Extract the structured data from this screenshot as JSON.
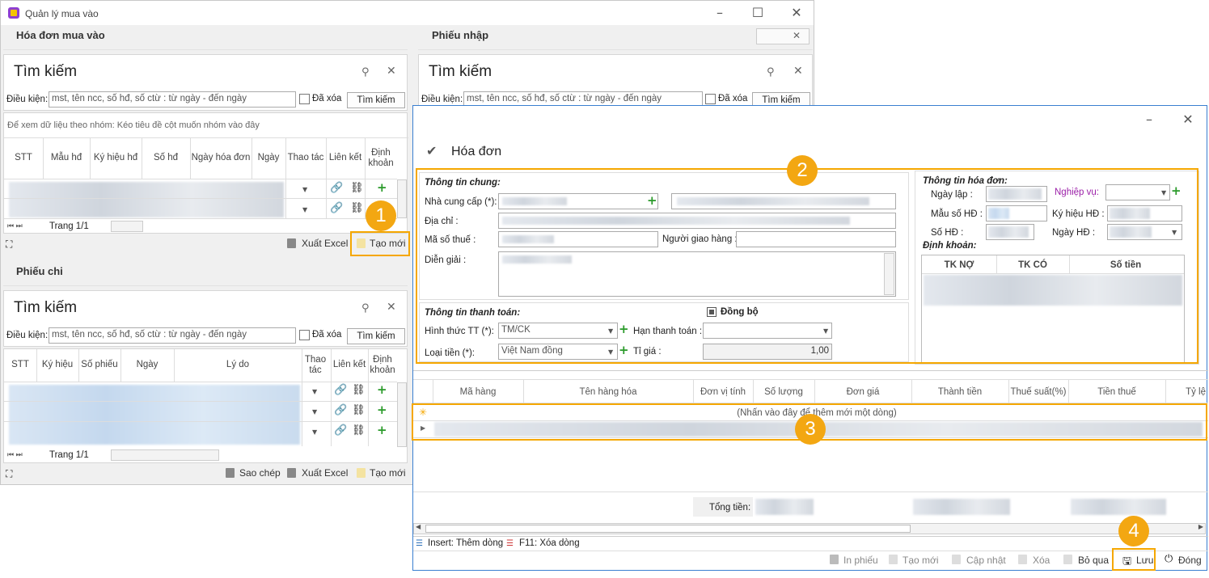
{
  "window": {
    "title": "Quản lý mua vào"
  },
  "hoa_don_mua_vao": {
    "section_title": "Hóa đơn mua vào",
    "search": {
      "title": "Tìm kiếm",
      "label": "Điều kiện:",
      "placeholder": "mst, tên ncc, số hđ, số ctừ : từ ngày - đến ngày",
      "deleted_label": "Đã xóa",
      "button": "Tìm kiếm"
    },
    "group_hint": "Để xem dữ liệu theo nhóm: Kéo tiêu đề cột muốn nhóm vào đây",
    "columns": [
      "STT",
      "Mẫu hđ",
      "Ký hiệu hđ",
      "Số hđ",
      "Ngày hóa đơn",
      "Ngày",
      "Thao tác",
      "Liên kết",
      "Định khoản"
    ],
    "pager": "Trang 1/1",
    "footer": {
      "excel": "Xuất Excel",
      "new": "Tạo mới"
    }
  },
  "phieu_nhap": {
    "section_title": "Phiếu nhập",
    "search": {
      "title": "Tìm kiếm",
      "label": "Điều kiện:",
      "placeholder": "mst, tên ncc, số hđ, số ctừ : từ ngày - đến ngày",
      "deleted_label": "Đã xóa",
      "button": "Tìm kiếm"
    }
  },
  "phieu_chi": {
    "section_title": "Phiếu chi",
    "search": {
      "title": "Tìm kiếm",
      "label": "Điều kiện:",
      "placeholder": "mst, tên ncc, số hđ, số ctừ : từ ngày - đến ngày",
      "deleted_label": "Đã xóa",
      "button": "Tìm kiếm"
    },
    "columns": [
      "STT",
      "Ký hiệu",
      "Số phiếu",
      "Ngày",
      "Lý do",
      "Thao tác",
      "Liên kết",
      "Định khoản"
    ],
    "pager": "Trang 1/1",
    "footer": {
      "copy": "Sao chép",
      "excel": "Xuất Excel",
      "new": "Tạo mới"
    }
  },
  "dialog": {
    "title": "Hóa đơn",
    "general": {
      "heading": "Thông tin chung:",
      "supplier": "Nhà cung cấp (*):",
      "address": "Địa chỉ :",
      "tax_code": "Mã số thuế :",
      "deliverer": "Người giao hàng :",
      "description": "Diễn giải :"
    },
    "payment": {
      "heading": "Thông tin thanh toán:",
      "sync": "Đồng bộ",
      "method_label": "Hình thức TT (*):",
      "method_value": "TM/CK",
      "due_label": "Hạn thanh toán :",
      "currency_label": "Loại tiền (*):",
      "currency_value": "Việt Nam đồng",
      "rate_label": "Tỉ giá :",
      "rate_value": "1,00"
    },
    "invoice": {
      "heading": "Thông tin hóa đơn:",
      "date": "Ngày lập :",
      "business": "Nghiệp vụ:",
      "template": "Mẫu số HĐ :",
      "symbol": "Ký hiệu HĐ :",
      "number": "Số HĐ :",
      "inv_date": "Ngày HĐ :",
      "accounting": "Định khoản:",
      "acc_columns": [
        "TK NỢ",
        "TK CÓ",
        "Số tiền"
      ]
    },
    "items": {
      "columns": [
        "Mã hàng",
        "Tên hàng hóa",
        "Đơn vị tính",
        "Số lượng",
        "Đơn giá",
        "Thành tiền",
        "Thuế suất(%)",
        "Tiền thuế",
        "Tỷ lệ"
      ],
      "new_row_hint": "(Nhấn vào đây để thêm mới một dòng)",
      "total_label": "Tổng tiền:"
    },
    "shortcuts": {
      "insert": "Insert: Thêm dòng",
      "delete": "F11: Xóa dòng"
    },
    "toolbar": {
      "print": "In phiếu",
      "new": "Tạo mới",
      "update": "Cập nhật",
      "delete": "Xóa",
      "skip": "Bỏ qua",
      "save": "Lưu",
      "close": "Đóng"
    }
  },
  "callouts": [
    "1",
    "2",
    "3",
    "4"
  ],
  "colors": {
    "callout": "#f3a712",
    "dialog_border": "#3a7fd0",
    "business_label": "#9b1fa8"
  }
}
